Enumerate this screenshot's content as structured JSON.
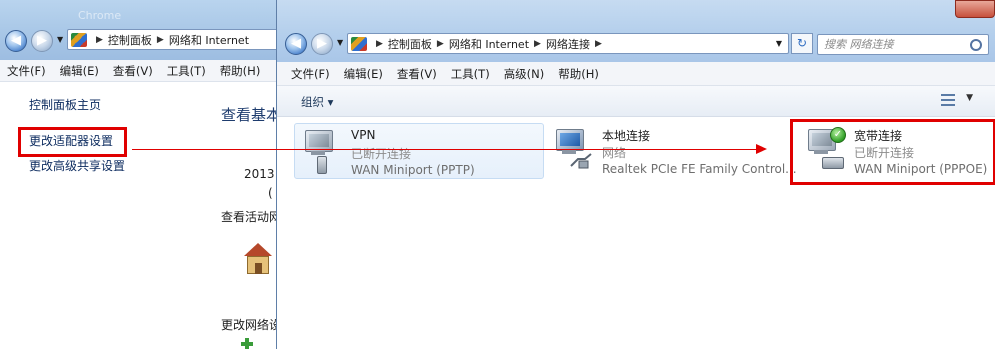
{
  "bg_window": {
    "ghost_text": "Chrome",
    "breadcrumb": [
      "控制面板",
      "网络和 Internet"
    ],
    "menu": [
      "文件(F)",
      "编辑(E)",
      "查看(V)",
      "工具(T)",
      "帮助(H)"
    ],
    "sidebar": {
      "home": "控制面板主页",
      "change_adapter": "更改适配器设置",
      "change_sharing": "更改高级共享设置"
    },
    "content": {
      "heading": "查看基本",
      "year": "2013",
      "paren": "(",
      "active_label": "查看活动网",
      "change_label": "更改网络设"
    }
  },
  "fg_window": {
    "breadcrumb": [
      "控制面板",
      "网络和 Internet",
      "网络连接"
    ],
    "search_placeholder": "搜索 网络连接",
    "menu": [
      "文件(F)",
      "编辑(E)",
      "查看(V)",
      "工具(T)",
      "高级(N)",
      "帮助(H)"
    ],
    "toolbar": {
      "organize": "组织 ▾"
    },
    "connections": [
      {
        "name": "VPN",
        "status": "已断开连接",
        "device": "WAN Miniport (PPTP)"
      },
      {
        "name": "本地连接",
        "status": "网络",
        "device": "Realtek PCIe FE Family Control..."
      },
      {
        "name": "宽带连接",
        "status": "已断开连接",
        "device": "WAN Miniport (PPPOE)"
      }
    ]
  },
  "colors": {
    "annotation_red": "#e00000",
    "link_blue": "#0c2b5f"
  }
}
